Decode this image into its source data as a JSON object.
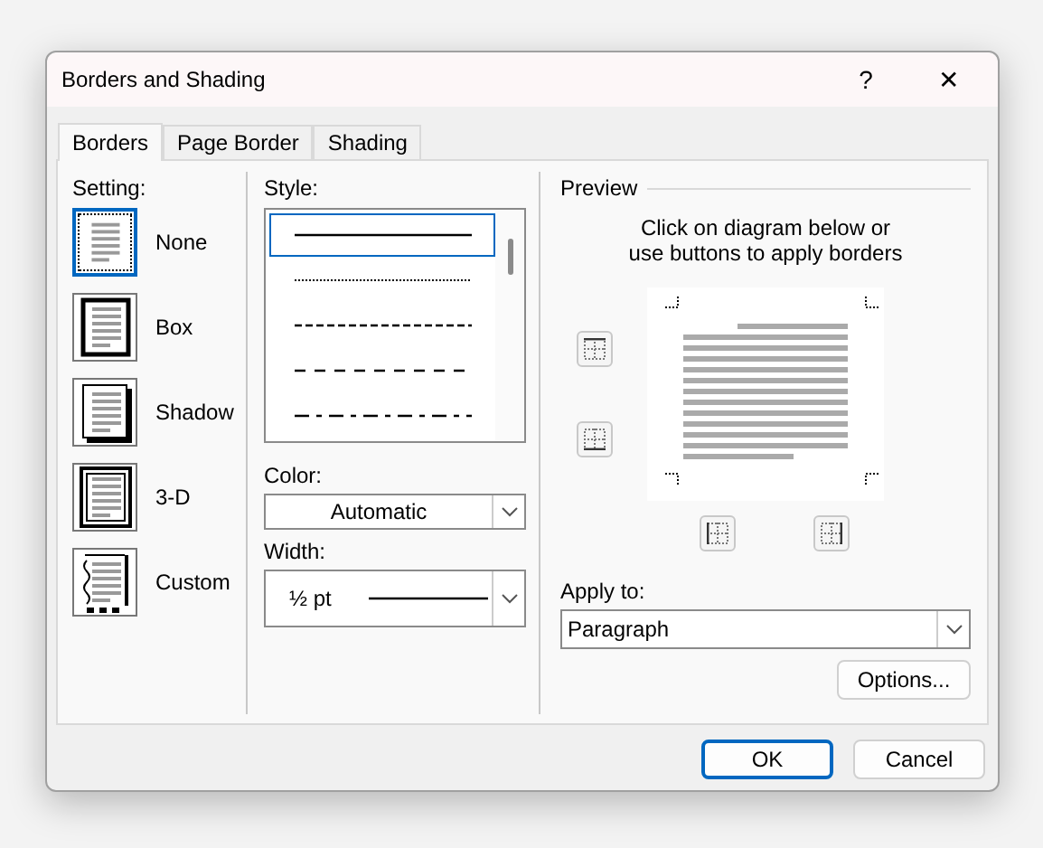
{
  "window": {
    "title": "Borders and Shading",
    "help": "?",
    "close": "✕"
  },
  "tabs": [
    {
      "label": "Borders",
      "selected": true
    },
    {
      "label": "Page Border",
      "selected": false
    },
    {
      "label": "Shading",
      "selected": false
    }
  ],
  "setting": {
    "label": "Setting:",
    "options": [
      {
        "label": "None",
        "kind": "none",
        "selected": true
      },
      {
        "label": "Box",
        "kind": "box",
        "selected": false
      },
      {
        "label": "Shadow",
        "kind": "shadow",
        "selected": false
      },
      {
        "label": "3-D",
        "kind": "threed",
        "selected": false
      },
      {
        "label": "Custom",
        "kind": "custom",
        "selected": false
      }
    ]
  },
  "style": {
    "label": "Style:",
    "options": [
      {
        "kind": "solid",
        "selected": true
      },
      {
        "kind": "dotted",
        "selected": false
      },
      {
        "kind": "dashed",
        "selected": false
      },
      {
        "kind": "longdash",
        "selected": false
      },
      {
        "kind": "dashdot",
        "selected": false
      }
    ]
  },
  "color": {
    "label": "Color:",
    "value": "Automatic"
  },
  "width": {
    "label": "Width:",
    "value": "½ pt"
  },
  "preview": {
    "label": "Preview",
    "hint": "Click on diagram below or use buttons to apply borders"
  },
  "apply_to": {
    "label": "Apply to:",
    "value": "Paragraph"
  },
  "options_button": "Options...",
  "buttons": [
    {
      "label": "OK",
      "default": true
    },
    {
      "label": "Cancel",
      "default": false
    }
  ]
}
